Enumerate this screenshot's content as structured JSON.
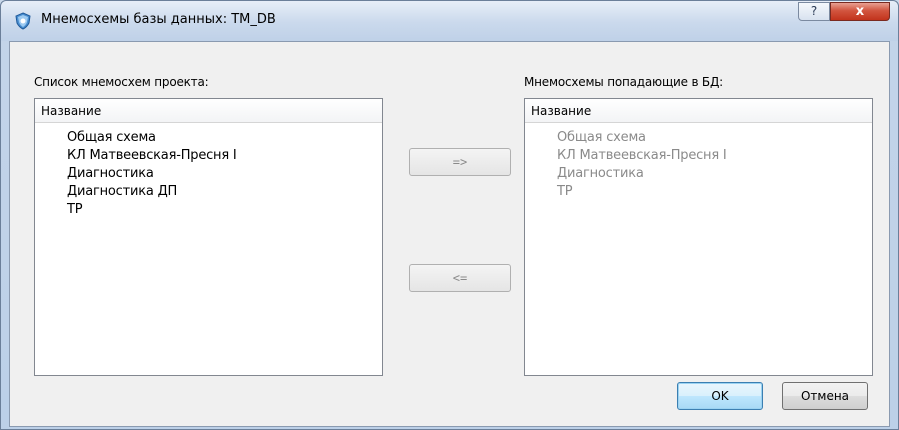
{
  "window": {
    "title": "Мнемосхемы базы данных: TM_DB",
    "help_label": "?",
    "close_label": "x",
    "icon": "app-shield-icon"
  },
  "left_panel": {
    "label": "Список мнемосхем проекта:",
    "header": "Название",
    "items": [
      "Общая схема",
      "КЛ Матвеевская-Пресня I",
      "Диагностика",
      "Диагностика ДП",
      "ТР"
    ]
  },
  "right_panel": {
    "label": "Мнемосхемы попадающие в БД:",
    "header": "Название",
    "items": [
      "Общая схема",
      "КЛ Матвеевская-Пресня I",
      "Диагностика",
      "ТР"
    ]
  },
  "transfer": {
    "add_label": "=>",
    "remove_label": "<="
  },
  "buttons": {
    "ok_label": "OK",
    "cancel_label": "Отмена"
  },
  "colors": {
    "disabled_text": "#8a8a8a",
    "close_button": "#c2331c",
    "default_button_border": "#3c7fb1"
  }
}
